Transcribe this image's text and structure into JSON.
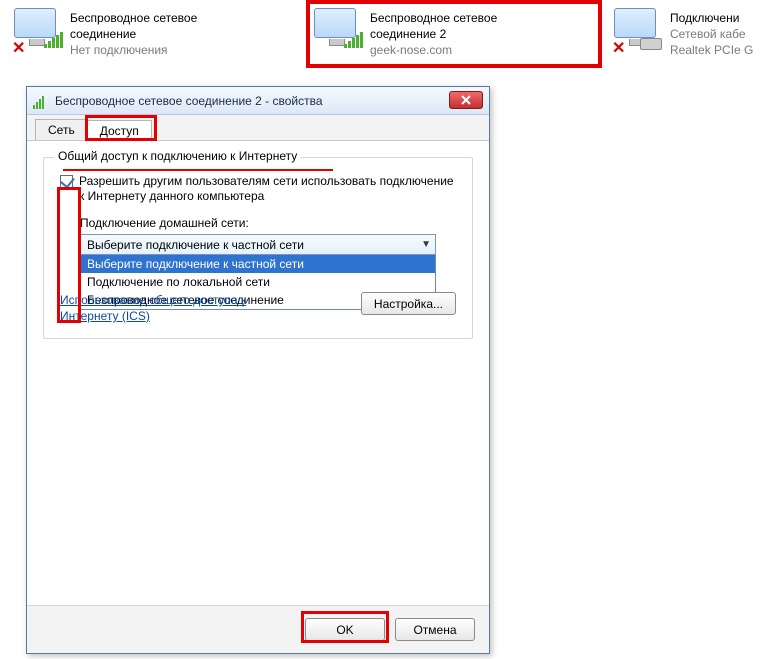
{
  "network_items": [
    {
      "title_l1": "Беспроводное сетевое",
      "title_l2": "соединение",
      "sub": "Нет подключения"
    },
    {
      "title_l1": "Беспроводное сетевое",
      "title_l2": "соединение 2",
      "sub": "geek-nose.com"
    },
    {
      "title_l1": "Подключени",
      "title_l2": "Сетевой кабе",
      "sub": "Realtek PCIe G"
    }
  ],
  "dialog": {
    "title": "Беспроводное сетевое соединение 2 - свойства",
    "tabs": {
      "network": "Сеть",
      "sharing": "Доступ"
    },
    "group_title": "Общий доступ к подключению к Интернету",
    "allow_label": "Разрешить другим пользователям сети использовать подключение к Интернету данного компьютера",
    "home_label": "Подключение домашней сети:",
    "combo_value": "Выберите подключение к частной сети",
    "combo_options": [
      "Выберите подключение к частной сети",
      "Подключение по локальной сети",
      "Беспроводное сетевое соединение"
    ],
    "ics_link": "Использование общего доступа к Интернету (ICS)",
    "settings_btn": "Настройка...",
    "ok": "OK",
    "cancel": "Отмена"
  }
}
